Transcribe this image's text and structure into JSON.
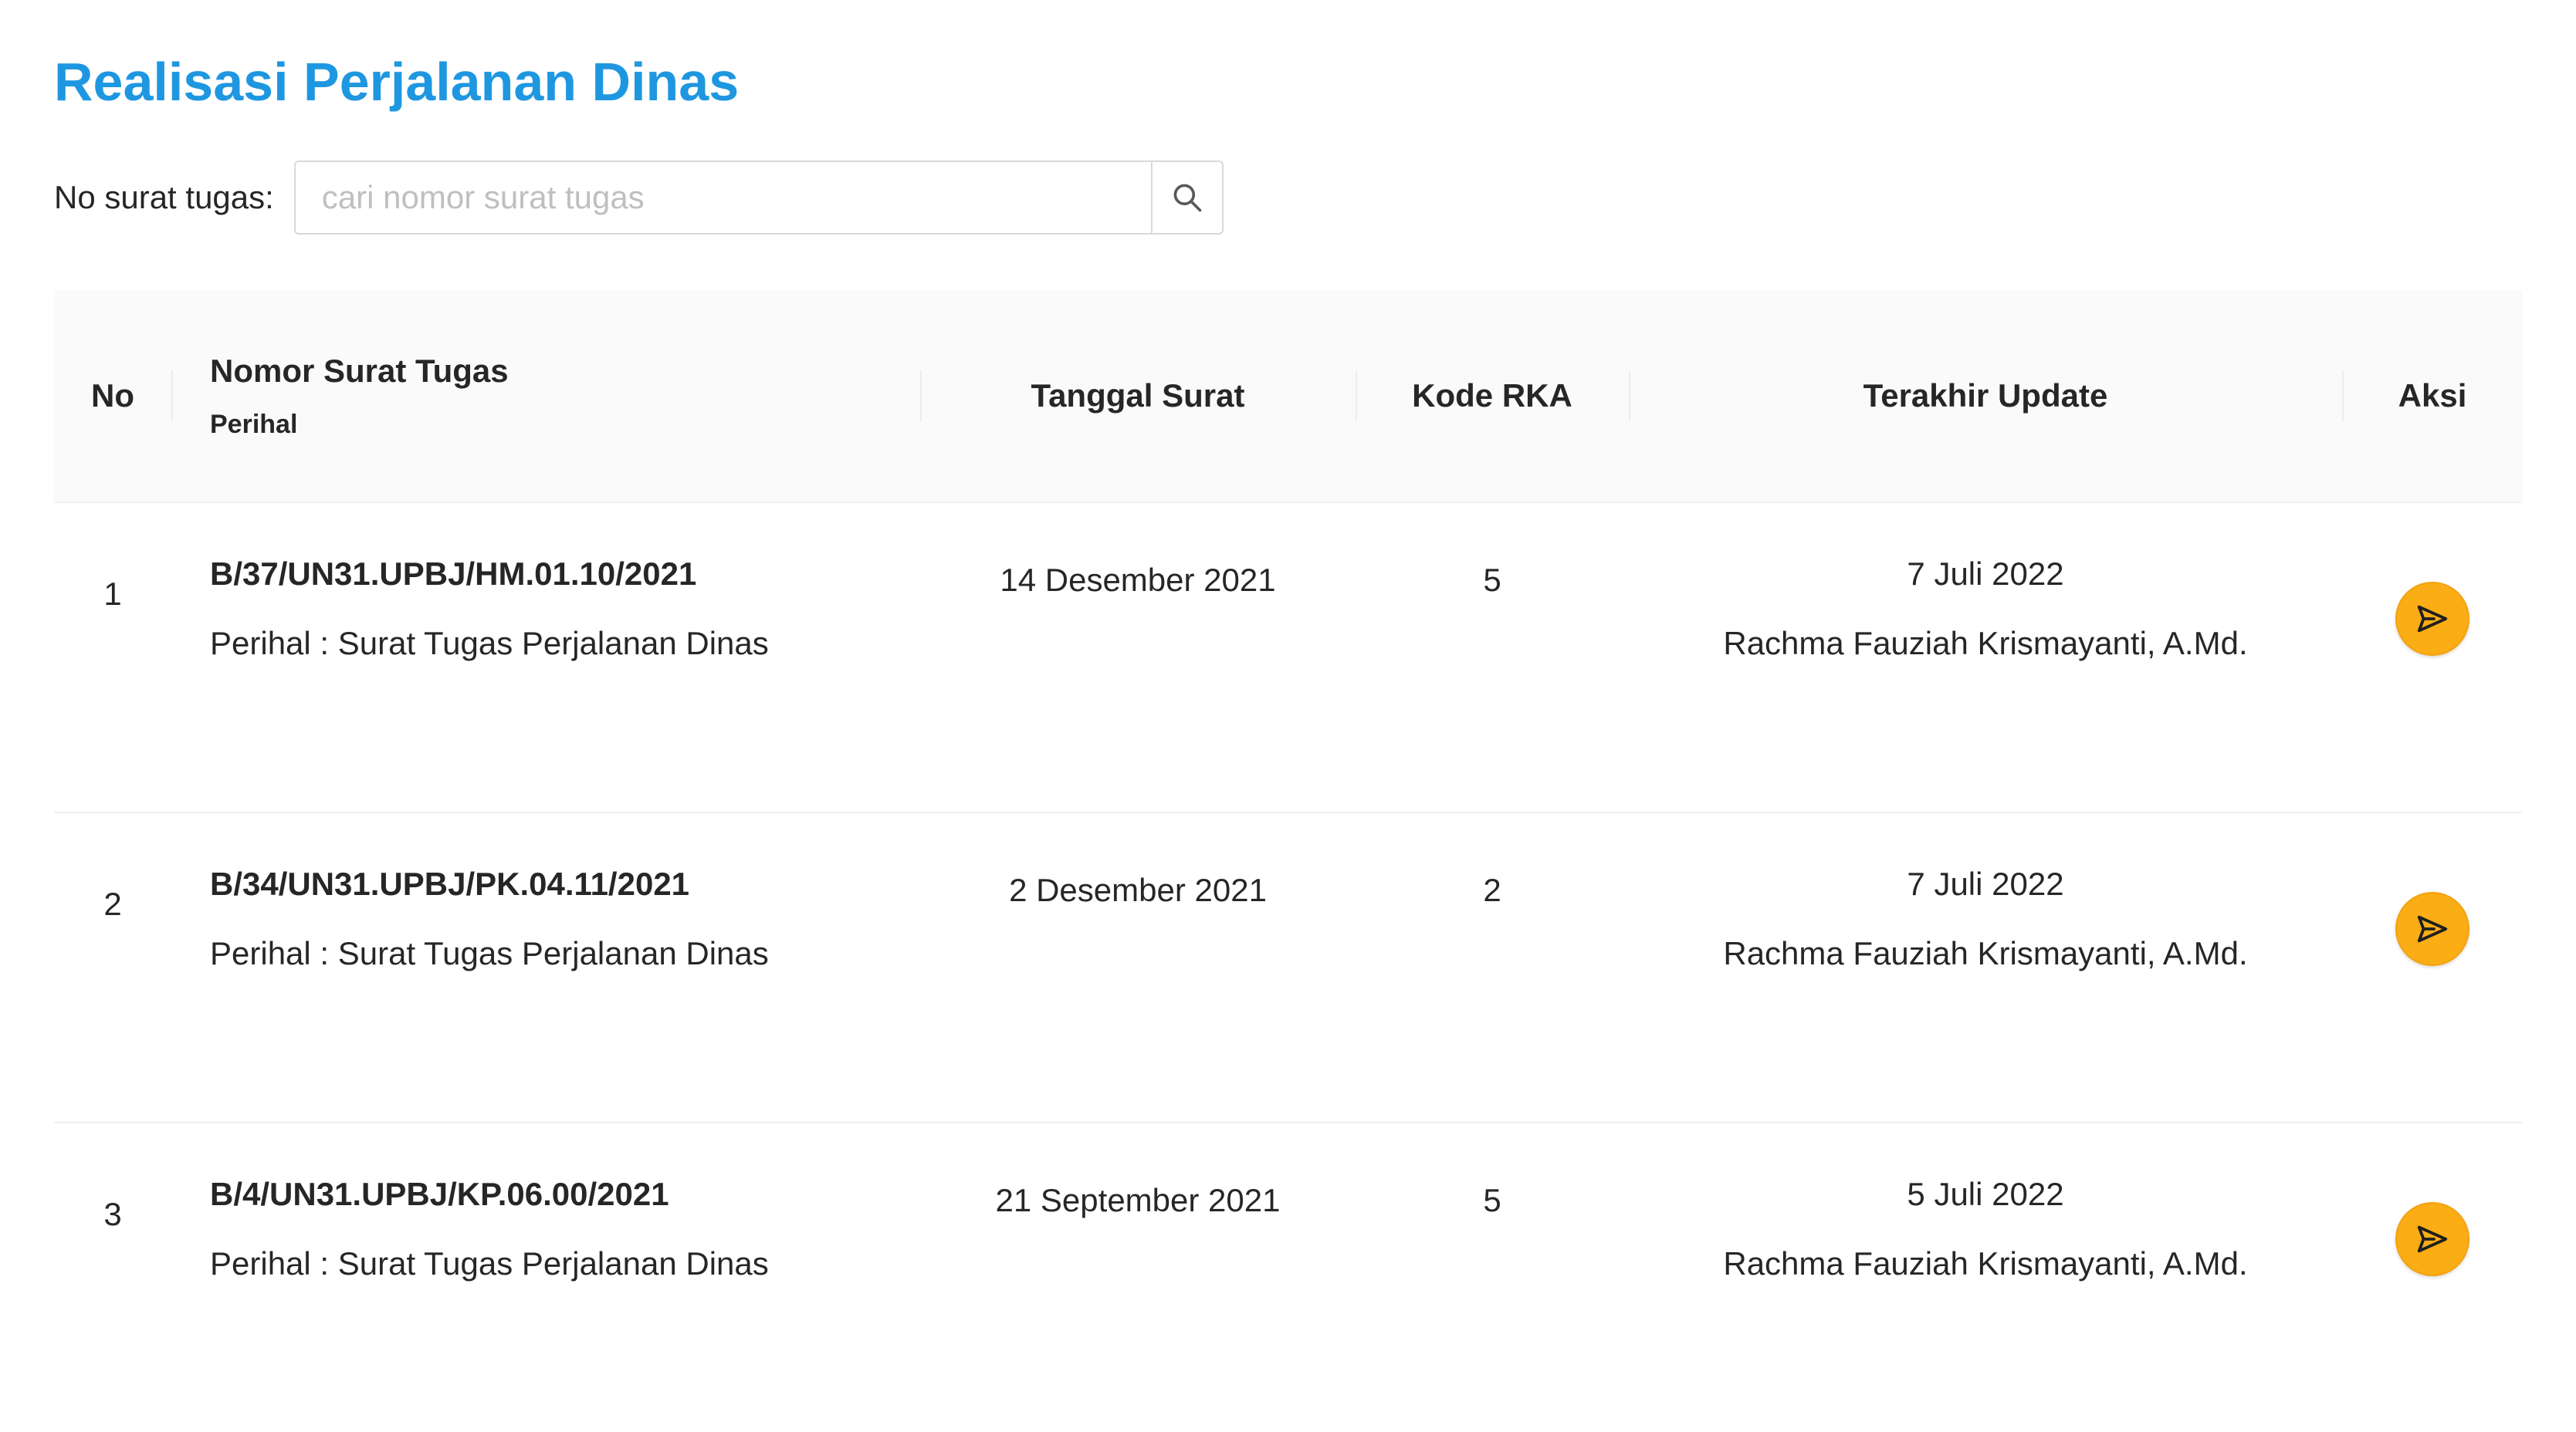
{
  "page": {
    "title": "Realisasi Perjalanan Dinas"
  },
  "search": {
    "label": "No surat tugas",
    "colon": ":",
    "placeholder": "cari nomor surat tugas",
    "value": "",
    "icon": "search-icon"
  },
  "table": {
    "headers": {
      "no": "No",
      "nomor": "Nomor Surat Tugas",
      "perihal": "Perihal",
      "tanggal": "Tanggal Surat",
      "kode": "Kode RKA",
      "update": "Terakhir Update",
      "aksi": "Aksi"
    },
    "rows": [
      {
        "no": "1",
        "nomor": "B/37/UN31.UPBJ/HM.01.10/2021",
        "perihal": "Perihal : Surat Tugas Perjalanan Dinas",
        "tanggal": "14 Desember 2021",
        "kode": "5",
        "update_date": "7 Juli 2022",
        "update_user": "Rachma Fauziah Krismayanti, A.Md.",
        "action_icon": "send-icon"
      },
      {
        "no": "2",
        "nomor": "B/34/UN31.UPBJ/PK.04.11/2021",
        "perihal": "Perihal : Surat Tugas Perjalanan Dinas",
        "tanggal": "2 Desember 2021",
        "kode": "2",
        "update_date": "7 Juli 2022",
        "update_user": "Rachma Fauziah Krismayanti, A.Md.",
        "action_icon": "send-icon"
      },
      {
        "no": "3",
        "nomor": "B/4/UN31.UPBJ/KP.06.00/2021",
        "perihal": "Perihal : Surat Tugas Perjalanan Dinas",
        "tanggal": "21 September 2021",
        "kode": "5",
        "update_date": "5 Juli 2022",
        "update_user": "Rachma Fauziah Krismayanti, A.Md.",
        "action_icon": "send-icon"
      }
    ]
  },
  "colors": {
    "title": "#1f97e0",
    "action_button": "#faad14",
    "header_bg": "#fafafa"
  }
}
